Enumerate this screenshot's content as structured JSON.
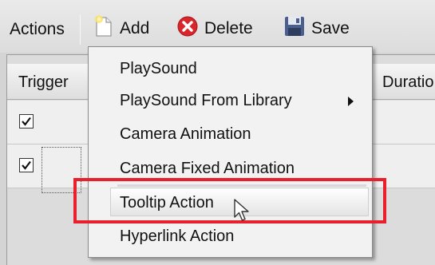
{
  "toolbar": {
    "title": "Actions",
    "add_label": "Add",
    "delete_label": "Delete",
    "save_label": "Save",
    "icons": {
      "add": "new-document-icon",
      "delete": "red-x-circle-icon",
      "save": "floppy-disk-icon"
    }
  },
  "grid": {
    "columns": [
      "Trigger",
      "Duratio"
    ],
    "rows": [
      {
        "trigger_checked": true
      },
      {
        "trigger_checked": true
      }
    ]
  },
  "menu": {
    "items": [
      "PlaySound",
      "PlaySound From Library",
      "Camera Animation",
      "Camera Fixed Animation",
      "Tooltip Action",
      "Hyperlink Action"
    ],
    "highlighted": "Tooltip Action"
  },
  "colors": {
    "annotation_red": "#e8202e",
    "delete_icon_red": "#d9262b",
    "save_icon_blue": "#4a5f8f"
  }
}
